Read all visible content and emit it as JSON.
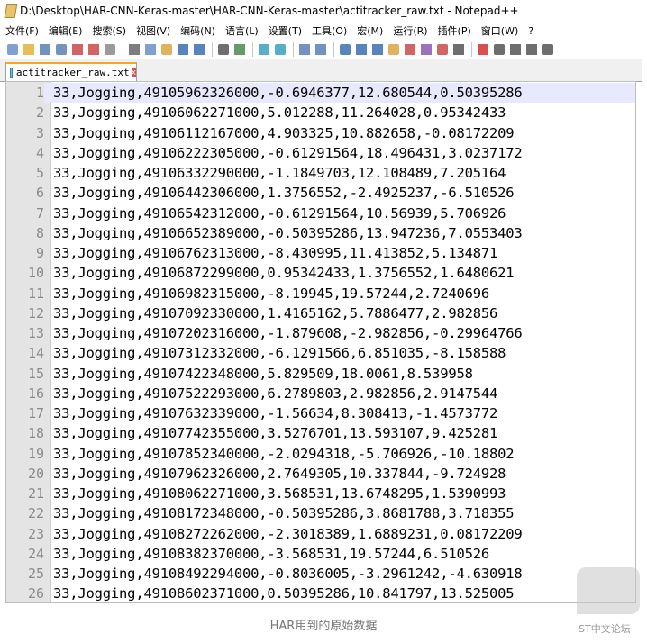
{
  "window": {
    "title": "D:\\Desktop\\HAR-CNN-Keras-master\\HAR-CNN-Keras-master\\actitracker_raw.txt - Notepad++"
  },
  "menu": [
    "文件(F)",
    "编辑(E)",
    "搜索(S)",
    "视图(V)",
    "编码(N)",
    "语言(L)",
    "设置(T)",
    "工具(O)",
    "宏(M)",
    "运行(R)",
    "插件(P)",
    "窗口(W)",
    "?"
  ],
  "toolbar_icons": [
    "new-file-icon",
    "open-file-icon",
    "save-icon",
    "save-all-icon",
    "close-icon",
    "close-all-icon",
    "print-icon",
    "cut-icon",
    "copy-icon",
    "paste-icon",
    "undo-icon",
    "redo-icon",
    "find-icon",
    "replace-icon",
    "zoom-in-icon",
    "zoom-out-icon",
    "sync-v-icon",
    "sync-h-icon",
    "word-wrap-icon",
    "all-chars-icon",
    "indent-guide-icon",
    "udl-icon",
    "doc-map-icon",
    "function-list-icon",
    "folder-workspace-icon",
    "monitor-icon",
    "record-macro-icon",
    "stop-record-icon",
    "play-macro-icon",
    "run-macro-multiple-icon",
    "save-macro-icon"
  ],
  "tab": {
    "label": "actitracker_raw.txt",
    "close": "x"
  },
  "lines": [
    {
      "n": "1",
      "text": "33,Jogging,49105962326000,-0.6946377,12.680544,0.50395286"
    },
    {
      "n": "2",
      "text": "33,Jogging,49106062271000,5.012288,11.264028,0.95342433"
    },
    {
      "n": "3",
      "text": "33,Jogging,49106112167000,4.903325,10.882658,-0.08172209"
    },
    {
      "n": "4",
      "text": "33,Jogging,49106222305000,-0.61291564,18.496431,3.0237172"
    },
    {
      "n": "5",
      "text": "33,Jogging,49106332290000,-1.1849703,12.108489,7.205164"
    },
    {
      "n": "6",
      "text": "33,Jogging,49106442306000,1.3756552,-2.4925237,-6.510526"
    },
    {
      "n": "7",
      "text": "33,Jogging,49106542312000,-0.61291564,10.56939,5.706926"
    },
    {
      "n": "8",
      "text": "33,Jogging,49106652389000,-0.50395286,13.947236,7.0553403"
    },
    {
      "n": "9",
      "text": "33,Jogging,49106762313000,-8.430995,11.413852,5.134871"
    },
    {
      "n": "10",
      "text": "33,Jogging,49106872299000,0.95342433,1.3756552,1.6480621"
    },
    {
      "n": "11",
      "text": "33,Jogging,49106982315000,-8.19945,19.57244,2.7240696"
    },
    {
      "n": "12",
      "text": "33,Jogging,49107092330000,1.4165162,5.7886477,2.982856"
    },
    {
      "n": "13",
      "text": "33,Jogging,49107202316000,-1.879608,-2.982856,-0.29964766"
    },
    {
      "n": "14",
      "text": "33,Jogging,49107312332000,-6.1291566,6.851035,-8.158588"
    },
    {
      "n": "15",
      "text": "33,Jogging,49107422348000,5.829509,18.0061,8.539958"
    },
    {
      "n": "16",
      "text": "33,Jogging,49107522293000,6.2789803,2.982856,2.9147544"
    },
    {
      "n": "17",
      "text": "33,Jogging,49107632339000,-1.56634,8.308413,-1.4573772"
    },
    {
      "n": "18",
      "text": "33,Jogging,49107742355000,3.5276701,13.593107,9.425281"
    },
    {
      "n": "19",
      "text": "33,Jogging,49107852340000,-2.0294318,-5.706926,-10.18802"
    },
    {
      "n": "20",
      "text": "33,Jogging,49107962326000,2.7649305,10.337844,-9.724928"
    },
    {
      "n": "21",
      "text": "33,Jogging,49108062271000,3.568531,13.6748295,1.5390993"
    },
    {
      "n": "22",
      "text": "33,Jogging,49108172348000,-0.50395286,3.8681788,3.718355"
    },
    {
      "n": "23",
      "text": "33,Jogging,49108272262000,-2.3018389,1.6889231,0.08172209"
    },
    {
      "n": "24",
      "text": "33,Jogging,49108382370000,-3.568531,19.57244,6.510526"
    },
    {
      "n": "25",
      "text": "33,Jogging,49108492294000,-0.8036005,-3.2961242,-4.630918"
    },
    {
      "n": "26",
      "text": "33,Jogging,49108602371000,0.50395286,10.841797,13.525005"
    }
  ],
  "caption": "HAR用到的原始数据",
  "watermark": "ST中文论坛",
  "colors": {
    "active_line": "#e8e8ff",
    "gutter": "#e4e4e4",
    "tab_accent": "#f5a623"
  }
}
